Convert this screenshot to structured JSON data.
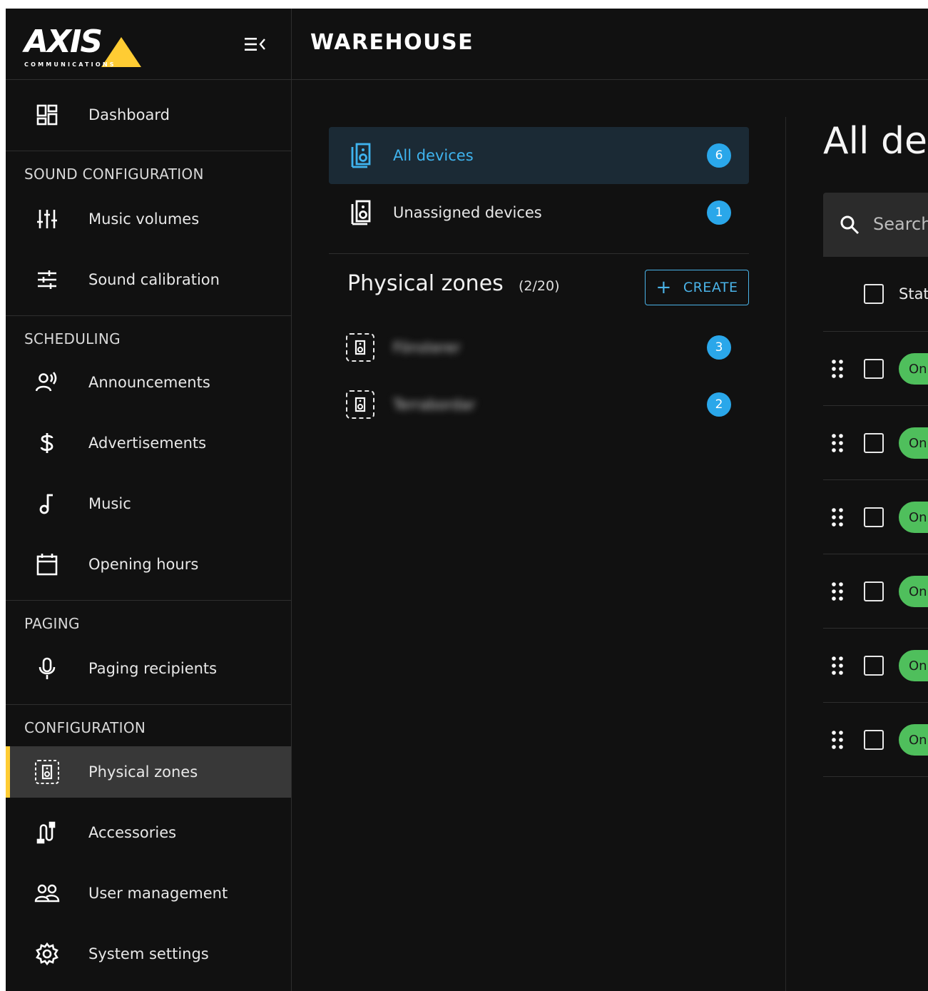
{
  "brand": {
    "wordmark": "AXIS",
    "subtitle": "COMMUNICATIONS",
    "accent": "#ffcc33"
  },
  "header": {
    "title": "WAREHOUSE",
    "collapse_icon": "menu-collapse-icon"
  },
  "sidebar": {
    "dashboard": {
      "label": "Dashboard",
      "icon": "dashboard-icon"
    },
    "sections": [
      {
        "heading": "SOUND CONFIGURATION",
        "items": [
          {
            "label": "Music volumes",
            "icon": "sliders-vertical-icon"
          },
          {
            "label": "Sound calibration",
            "icon": "tune-icon"
          }
        ]
      },
      {
        "heading": "SCHEDULING",
        "items": [
          {
            "label": "Announcements",
            "icon": "announcement-icon"
          },
          {
            "label": "Advertisements",
            "icon": "dollar-icon"
          },
          {
            "label": "Music",
            "icon": "music-note-icon"
          },
          {
            "label": "Opening hours",
            "icon": "calendar-icon"
          }
        ]
      },
      {
        "heading": "PAGING",
        "items": [
          {
            "label": "Paging recipients",
            "icon": "microphone-icon"
          }
        ]
      },
      {
        "heading": "CONFIGURATION",
        "items": [
          {
            "label": "Physical zones",
            "icon": "zone-speaker-icon",
            "active": true
          },
          {
            "label": "Accessories",
            "icon": "accessories-icon"
          },
          {
            "label": "User management",
            "icon": "users-icon"
          },
          {
            "label": "System settings",
            "icon": "gear-icon"
          }
        ]
      }
    ]
  },
  "zones_panel": {
    "all_devices": {
      "label": "All devices",
      "count": "6",
      "selected": true
    },
    "unassigned": {
      "label": "Unassigned devices",
      "count": "1"
    },
    "physical_zones": {
      "title": "Physical zones",
      "count_text": "(2/20)",
      "create_label": "CREATE"
    },
    "zones": [
      {
        "name": "Fönsterer",
        "count": "3"
      },
      {
        "name": "Terrabordar",
        "count": "2"
      }
    ]
  },
  "devices_panel": {
    "title": "All devices",
    "search_placeholder": "Search",
    "status_header": "Status",
    "rows": [
      {
        "status": "Online"
      },
      {
        "status": "Online"
      },
      {
        "status": "Online"
      },
      {
        "status": "Online"
      },
      {
        "status": "Online"
      },
      {
        "status": "Online"
      }
    ],
    "status_color": "#4fbf5c"
  }
}
